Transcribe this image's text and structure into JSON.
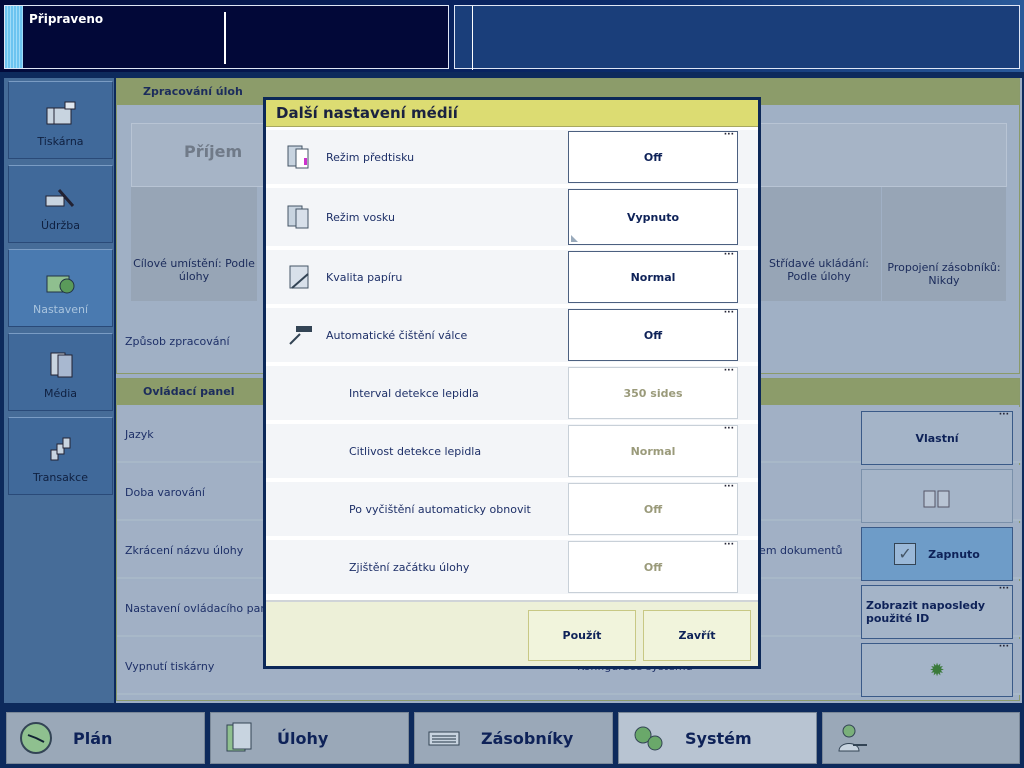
{
  "status": {
    "text": "Připraveno"
  },
  "sidebar": {
    "items": [
      {
        "label": "Tiskárna"
      },
      {
        "label": "Údržba"
      },
      {
        "label": "Nastavení",
        "active": true
      },
      {
        "label": "Média"
      },
      {
        "label": "Transakce"
      }
    ]
  },
  "job_processing": {
    "title": "Zpracování úloh",
    "receive": "Příjem",
    "tiles": [
      "Cílové umístění: Podle úlohy",
      "Střídavé ukládání: Podle úlohy",
      "Propojení zásobníků: Nikdy"
    ],
    "row": "Způsob zpracování"
  },
  "control_panel": {
    "title": "Ovládací panel",
    "rows": [
      "Jazyk",
      "Doba varování",
      "Zkrácení názvu úlohy",
      "Nastavení ovládacího panelu",
      "Vypnutí tiskárny"
    ],
    "right_label": "čem dokumentů",
    "bottom_label": "Konfigurace systému",
    "buttons": {
      "language": "Vlastní",
      "enabled": "Zapnuto",
      "show_id": "Zobrazit naposledy použité ID"
    }
  },
  "dialog": {
    "title": "Další nastavení médií",
    "rows": [
      {
        "label": "Režim předtisku",
        "value": "Off"
      },
      {
        "label": "Režim vosku",
        "value": "Vypnuto"
      },
      {
        "label": "Kvalita papíru",
        "value": "Normal"
      },
      {
        "label": "Automatické čištění válce",
        "value": "Off"
      },
      {
        "label": "Interval detekce lepidla",
        "value": "350 sides"
      },
      {
        "label": "Citlivost detekce lepidla",
        "value": "Normal"
      },
      {
        "label": "Po vyčištění automaticky obnovit",
        "value": "Off"
      },
      {
        "label": "Zjištění začátku úlohy",
        "value": "Off"
      }
    ],
    "apply": "Použít",
    "close": "Zavřít"
  },
  "bottom_nav": [
    {
      "label": "Plán"
    },
    {
      "label": "Úlohy"
    },
    {
      "label": "Zásobníky"
    },
    {
      "label": "Systém",
      "active": true
    }
  ],
  "dots": "···"
}
